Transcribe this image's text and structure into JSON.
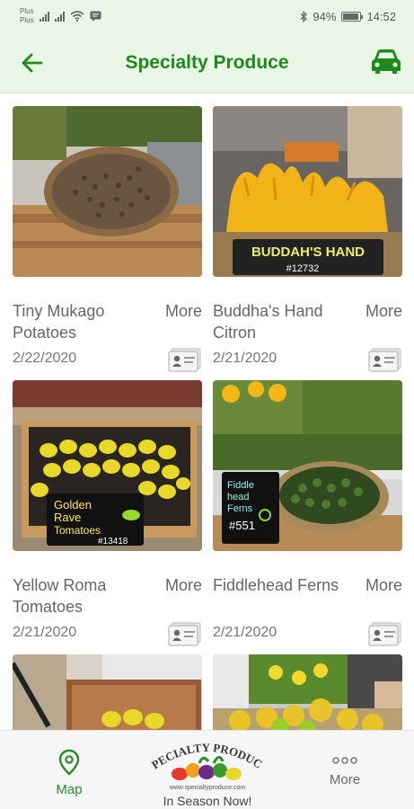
{
  "status": {
    "carrier_top": "Plus",
    "carrier_bottom": "Plus",
    "battery": "94%",
    "time": "14:52"
  },
  "header": {
    "title": "Specialty Produce"
  },
  "cards": [
    {
      "title": "Tiny Mukago Potatoes",
      "more": "More",
      "date": "2/22/2020"
    },
    {
      "title": "Buddha's Hand Citron",
      "more": "More",
      "date": "2/21/2020",
      "sign": "BUDDAH'S HAND",
      "sign_code": "#12732"
    },
    {
      "title": "Yellow Roma Tomatoes",
      "more": "More",
      "date": "2/21/2020",
      "sign_line1": "Golden",
      "sign_line2": "Rave",
      "sign_line3": "Tomatoes",
      "sign_code": "#13418"
    },
    {
      "title": "Fiddlehead Ferns",
      "more": "More",
      "date": "2/21/2020",
      "sign_line1": "Fiddle",
      "sign_line2": "head",
      "sign_line3": "Ferns",
      "sign_code": "#551"
    },
    {
      "title": "",
      "more": "",
      "date": ""
    },
    {
      "title": "",
      "more": "",
      "date": ""
    }
  ],
  "bottom_nav": {
    "map_label": "Map",
    "logo_text": "SPECIALTY PRODUCE",
    "logo_url": "www.specialtyproduce.com",
    "logo_caption": "In Season Now!",
    "more_label": "More"
  },
  "colors": {
    "brand_green": "#1d8a1d",
    "header_bg": "#e9f6e6"
  }
}
